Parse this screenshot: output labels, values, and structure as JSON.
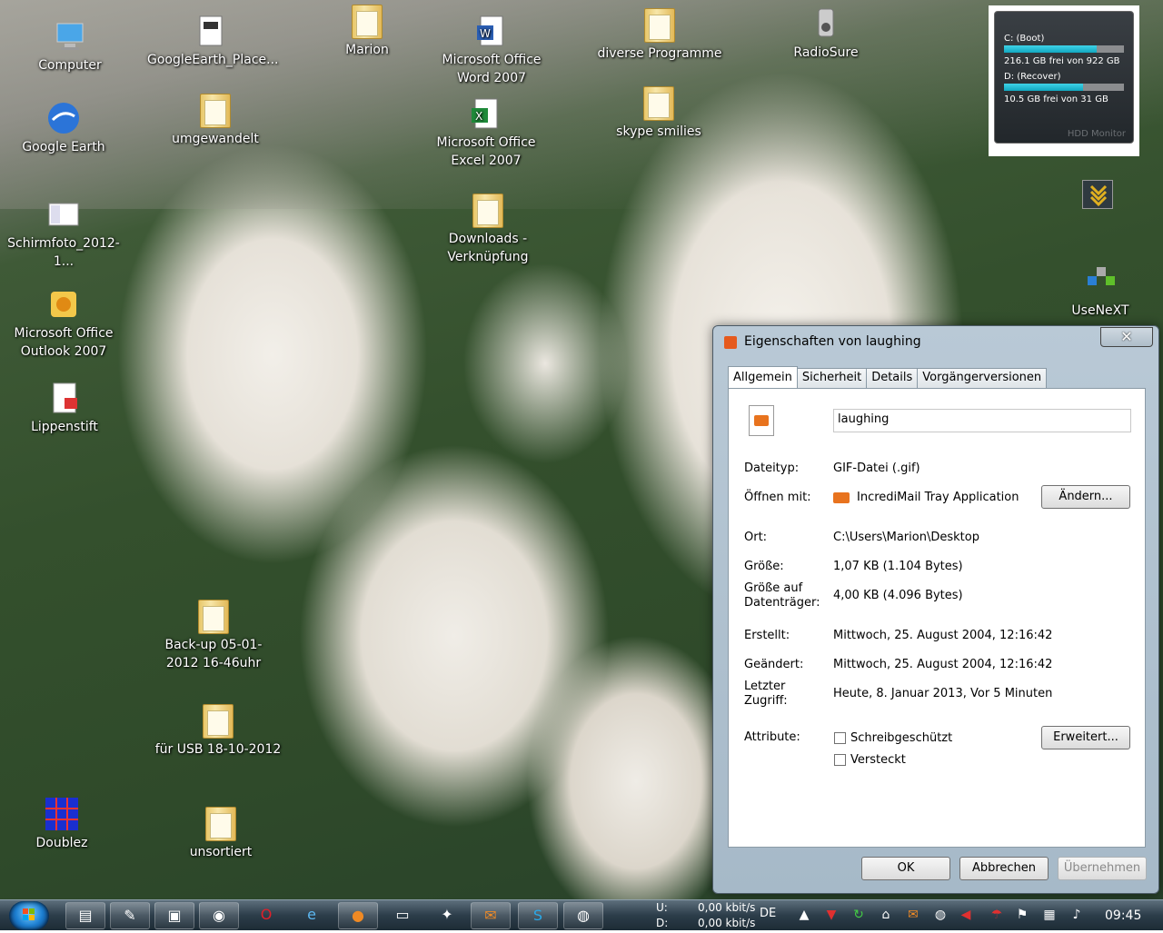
{
  "desktop": {
    "icons": [
      {
        "label": "Computer"
      },
      {
        "label": "Google Earth"
      },
      {
        "label": "Schirmfoto_2012-1..."
      },
      {
        "label": "Microsoft Office Outlook 2007"
      },
      {
        "label": "Lippenstift"
      },
      {
        "label": "Doublez"
      },
      {
        "label": "GoogleEarth_Place..."
      },
      {
        "label": "umgewandelt"
      },
      {
        "label": "Back-up 05-01-2012 16-46uhr"
      },
      {
        "label": "für USB 18-10-2012"
      },
      {
        "label": "unsortiert"
      },
      {
        "label": "Marion"
      },
      {
        "label": "Microsoft Office Word 2007"
      },
      {
        "label": "Microsoft Office Excel 2007"
      },
      {
        "label": "Downloads - Verknüpfung"
      },
      {
        "label": "diverse Programme"
      },
      {
        "label": "skype smilies"
      },
      {
        "label": "RadioSure"
      },
      {
        "label": "UseNeXT"
      }
    ]
  },
  "gadget": {
    "drives": [
      {
        "name": "C: (Boot)",
        "free_text": "216.1 GB frei von 922 GB",
        "used_fraction": 0.77
      },
      {
        "name": "D: (Recover)",
        "free_text": "10.5 GB frei von 31 GB",
        "used_fraction": 0.66
      }
    ],
    "brand": "HDD Monitor"
  },
  "dialog": {
    "title": "Eigenschaften von laughing",
    "close_glyph": "✕",
    "tabs": [
      "Allgemein",
      "Sicherheit",
      "Details",
      "Vorgängerversionen"
    ],
    "filename": "laughing",
    "dateityp_label": "Dateityp:",
    "dateityp_value": "GIF-Datei (.gif)",
    "oeffnen_label": "Öffnen mit:",
    "oeffnen_value": "IncrediMail Tray Application",
    "aendern_button": "Ändern...",
    "ort_label": "Ort:",
    "ort_value": "C:\\Users\\Marion\\Desktop",
    "groesse_label": "Größe:",
    "groesse_value": "1,07 KB (1.104 Bytes)",
    "groesse_auf_label": "Größe auf Datenträger:",
    "groesse_auf_value": "4,00 KB (4.096 Bytes)",
    "erstellt_label": "Erstellt:",
    "erstellt_value": "Mittwoch, 25. August 2004, 12:16:42",
    "geaendert_label": "Geändert:",
    "geaendert_value": "Mittwoch, 25. August 2004, 12:16:42",
    "zugriff_label": "Letzter Zugriff:",
    "zugriff_value": "Heute, 8. Januar 2013, Vor 5 Minuten",
    "attribute_label": "Attribute:",
    "schreibgeschuetzt": "Schreibgeschützt",
    "versteckt": "Versteckt",
    "erweitert_button": "Erweitert...",
    "ok_button": "OK",
    "abbrechen_button": "Abbrechen",
    "uebernehmen_button": "Übernehmen"
  },
  "taskbar": {
    "net_up_label": "U:",
    "net_up_value": "0,00 kbit/s",
    "net_down_label": "D:",
    "net_down_value": "0,00 kbit/s",
    "language": "DE",
    "clock": "09:45"
  }
}
